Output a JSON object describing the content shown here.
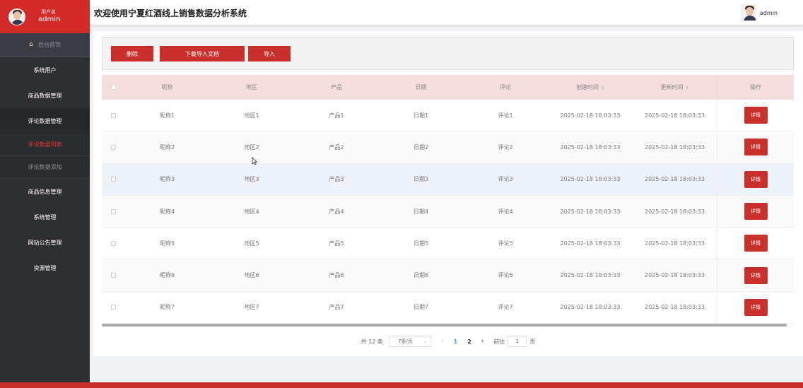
{
  "sidebar": {
    "role_label": "用户名",
    "username": "admin",
    "home_label": "后台首页",
    "items": [
      {
        "label": "系统用户"
      },
      {
        "label": "商品数据管理"
      },
      {
        "label": "评论数据管理"
      },
      {
        "label": "商品信息管理"
      },
      {
        "label": "系统管理"
      },
      {
        "label": "网站公告管理"
      },
      {
        "label": "资源管理"
      }
    ],
    "sub_items": [
      {
        "label": "评论数据列表"
      },
      {
        "label": "评论数据添加"
      }
    ]
  },
  "header": {
    "title": "欢迎使用宁夏红酒线上销售数据分析系统",
    "username": "admin"
  },
  "toolbar": {
    "delete_label": "删除",
    "download_label": "下载导入文档",
    "import_label": "导入"
  },
  "table": {
    "columns": [
      "昵称",
      "地区",
      "产品",
      "日期",
      "评论",
      "创建时间",
      "更新时间",
      "操作"
    ],
    "rows": [
      {
        "name": "昵称1",
        "area": "地区1",
        "product": "产品1",
        "date": "日期1",
        "review": "评论1",
        "created": "2025-02-18 18:03:33",
        "updated": "2025-02-18 18:03:33",
        "action": "详情"
      },
      {
        "name": "昵称2",
        "area": "地区2",
        "product": "产品2",
        "date": "日期2",
        "review": "评论2",
        "created": "2025-02-18 18:03:33",
        "updated": "2025-02-18 18:03:33",
        "action": "详情"
      },
      {
        "name": "昵称3",
        "area": "地区3",
        "product": "产品3",
        "date": "日期3",
        "review": "评论3",
        "created": "2025-02-18 18:03:33",
        "updated": "2025-02-18 18:03:33",
        "action": "详情"
      },
      {
        "name": "昵称4",
        "area": "地区4",
        "product": "产品4",
        "date": "日期4",
        "review": "评论4",
        "created": "2025-02-18 18:03:33",
        "updated": "2025-02-18 18:03:33",
        "action": "详情"
      },
      {
        "name": "昵称5",
        "area": "地区5",
        "product": "产品5",
        "date": "日期5",
        "review": "评论5",
        "created": "2025-02-18 18:03:33",
        "updated": "2025-02-18 18:03:33",
        "action": "详情"
      },
      {
        "name": "昵称6",
        "area": "地区6",
        "product": "产品6",
        "date": "日期6",
        "review": "评论6",
        "created": "2025-02-18 18:03:33",
        "updated": "2025-02-18 18:03:33",
        "action": "详情"
      },
      {
        "name": "昵称7",
        "area": "地区7",
        "product": "产品7",
        "date": "日期7",
        "review": "评论7",
        "created": "2025-02-18 18:03:33",
        "updated": "2025-02-18 18:03:33",
        "action": "详情"
      }
    ]
  },
  "pagination": {
    "total_label": "共 12 条",
    "page_size_label": "7条/页",
    "pages": [
      "1",
      "2"
    ],
    "current_page": "1",
    "goto_label": "前往",
    "goto_value": "1",
    "page_word": "页"
  },
  "icons": {
    "home": "home-icon",
    "sort": "sort-icon",
    "prev": "chevron-left-icon",
    "next": "chevron-right-icon",
    "dropdown": "chevron-down-icon"
  },
  "colors": {
    "brand_red": "#c9302c",
    "sidebar_bg": "#2d2f33",
    "table_header_bg": "#f4dede",
    "active_page": "#409eff"
  }
}
